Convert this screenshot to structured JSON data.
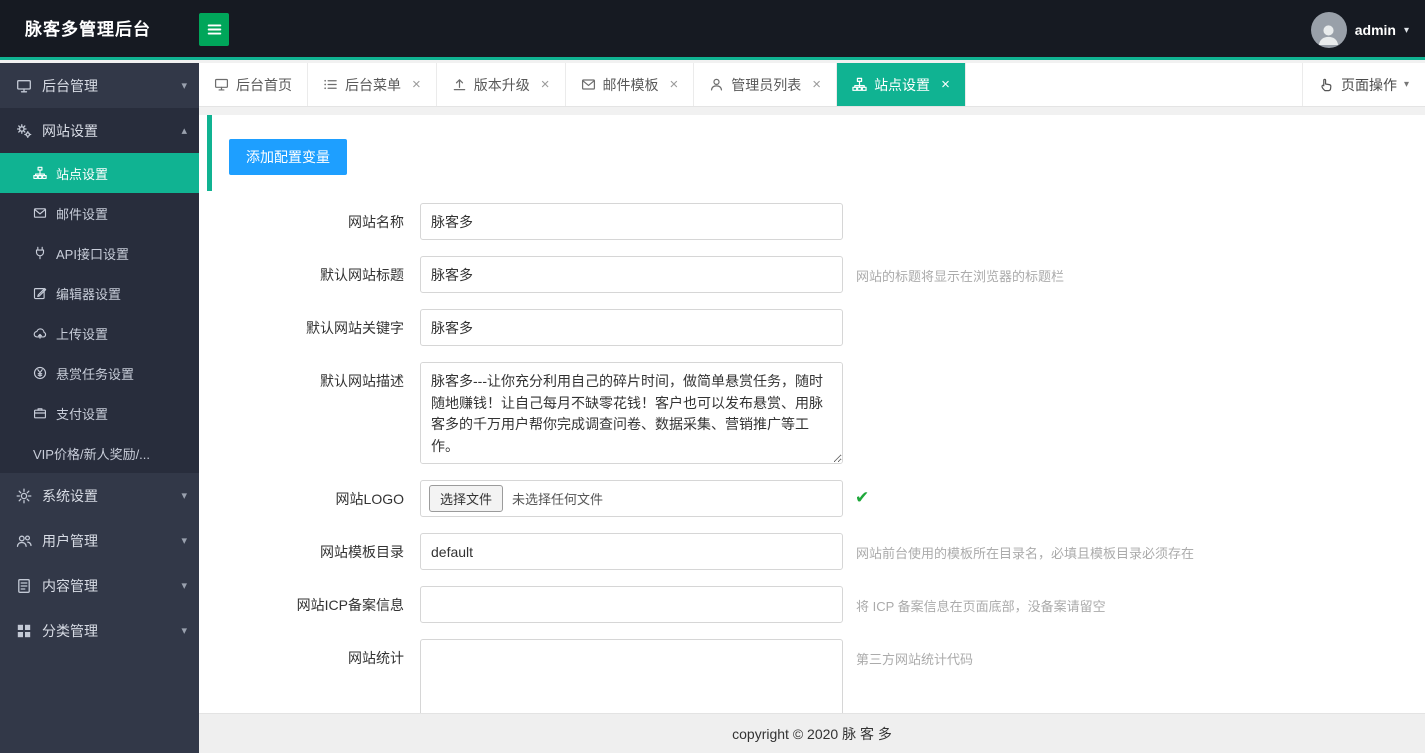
{
  "header": {
    "title": "脉客多管理后台",
    "user": "admin"
  },
  "glyphs": {
    "caret_down": "▾",
    "caret_up": "▴",
    "close": "×",
    "check": "✔"
  },
  "colors": {
    "accent_teal": "#10b392",
    "hamburger_green": "#00a65a",
    "button_blue": "#1e9fff",
    "header_bg": "#161a22",
    "sidebar_bg": "#323848"
  },
  "sidebar": {
    "items": [
      {
        "label": "后台管理",
        "icon": "desktop-icon"
      },
      {
        "label": "网站设置",
        "icon": "gears-icon",
        "expanded": true,
        "children": [
          {
            "label": "站点设置",
            "icon": "sitemap-icon",
            "active": true
          },
          {
            "label": "邮件设置",
            "icon": "envelope-icon"
          },
          {
            "label": "API接口设置",
            "icon": "plug-icon"
          },
          {
            "label": "编辑器设置",
            "icon": "edit-icon"
          },
          {
            "label": "上传设置",
            "icon": "cloud-upload-icon"
          },
          {
            "label": "悬赏任务设置",
            "icon": "yen-icon"
          },
          {
            "label": "支付设置",
            "icon": "briefcase-icon"
          },
          {
            "label": "VIP价格/新人奖励/..."
          }
        ]
      },
      {
        "label": "系统设置",
        "icon": "gear-icon"
      },
      {
        "label": "用户管理",
        "icon": "users-icon"
      },
      {
        "label": "内容管理",
        "icon": "document-icon"
      },
      {
        "label": "分类管理",
        "icon": "grid-icon"
      }
    ]
  },
  "tabs": {
    "items": [
      {
        "label": "后台首页",
        "icon": "desktop-icon",
        "closable": false
      },
      {
        "label": "后台菜单",
        "icon": "list-icon",
        "closable": true
      },
      {
        "label": "版本升级",
        "icon": "upload-icon",
        "closable": true
      },
      {
        "label": "邮件模板",
        "icon": "envelope-icon",
        "closable": true
      },
      {
        "label": "管理员列表",
        "icon": "user-icon",
        "closable": true
      },
      {
        "label": "站点设置",
        "icon": "sitemap-icon",
        "closable": true,
        "active": true
      }
    ],
    "page_actions_label": "页面操作"
  },
  "toolbar": {
    "add_button": "添加配置变量"
  },
  "form": {
    "fields": [
      {
        "label": "网站名称",
        "type": "input",
        "value": "脉客多",
        "hint": ""
      },
      {
        "label": "默认网站标题",
        "type": "input",
        "value": "脉客多",
        "hint": "网站的标题将显示在浏览器的标题栏"
      },
      {
        "label": "默认网站关键字",
        "type": "input",
        "value": "脉客多",
        "hint": ""
      },
      {
        "label": "默认网站描述",
        "type": "textarea",
        "value": "脉客多---让你充分利用自己的碎片时间，做简单悬赏任务，随时随地赚钱！让自己每月不缺零花钱！客户也可以发布悬赏、用脉客多的千万用户帮你完成调查问卷、数据采集、营销推广等工作。",
        "hint": ""
      },
      {
        "label": "网站LOGO",
        "type": "file",
        "button_label": "选择文件",
        "value": "未选择任何文件",
        "hint": "",
        "checked": true
      },
      {
        "label": "网站模板目录",
        "type": "input",
        "value": "default",
        "hint": "网站前台使用的模板所在目录名，必填且模板目录必须存在"
      },
      {
        "label": "网站ICP备案信息",
        "type": "input",
        "value": "",
        "hint": "将 ICP 备案信息在页面底部，没备案请留空"
      },
      {
        "label": "网站统计",
        "type": "textarea",
        "value": "",
        "hint": "第三方网站统计代码"
      }
    ]
  },
  "footer": {
    "copyright": "copyright © 2020 脉 客 多"
  }
}
